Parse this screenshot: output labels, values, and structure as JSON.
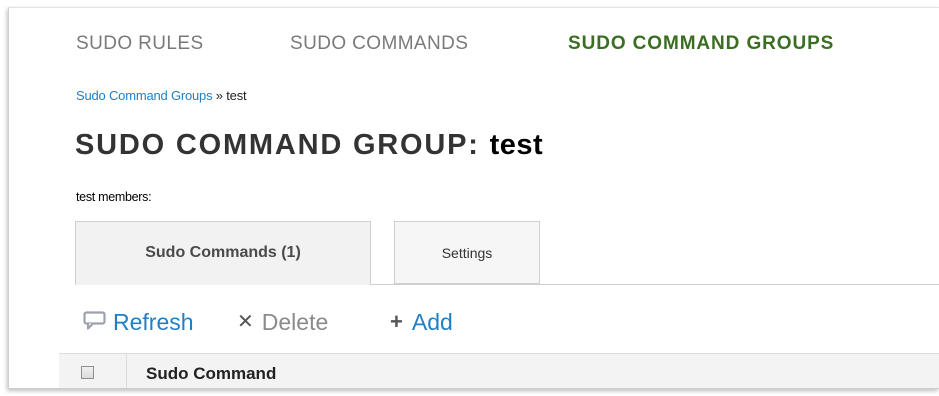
{
  "nav": {
    "items": [
      {
        "label": "SUDO RULES",
        "active": false
      },
      {
        "label": "SUDO COMMANDS",
        "active": false
      },
      {
        "label": "SUDO COMMAND GROUPS",
        "active": true
      }
    ],
    "active_color": "#3b6e22"
  },
  "breadcrumb": {
    "parent": "Sudo Command Groups",
    "separator": " » ",
    "current": "test"
  },
  "page": {
    "title_prefix": "SUDO COMMAND GROUP:",
    "title_entity": "test",
    "members_label": "test members:"
  },
  "tabs": [
    {
      "label": "Sudo Commands (1)",
      "active": true
    },
    {
      "label": "Settings",
      "active": false
    }
  ],
  "toolbar": {
    "refresh": {
      "label": "Refresh",
      "icon": "refresh-icon"
    },
    "delete": {
      "label": "Delete",
      "icon": "delete-x-icon",
      "enabled": false
    },
    "add": {
      "label": "Add",
      "icon": "plus-icon"
    }
  },
  "table": {
    "columns": [
      "Sudo Command"
    ]
  },
  "colors": {
    "link": "#1f80c8",
    "active_nav": "#3b6e22",
    "disabled": "#8a8a8a"
  }
}
